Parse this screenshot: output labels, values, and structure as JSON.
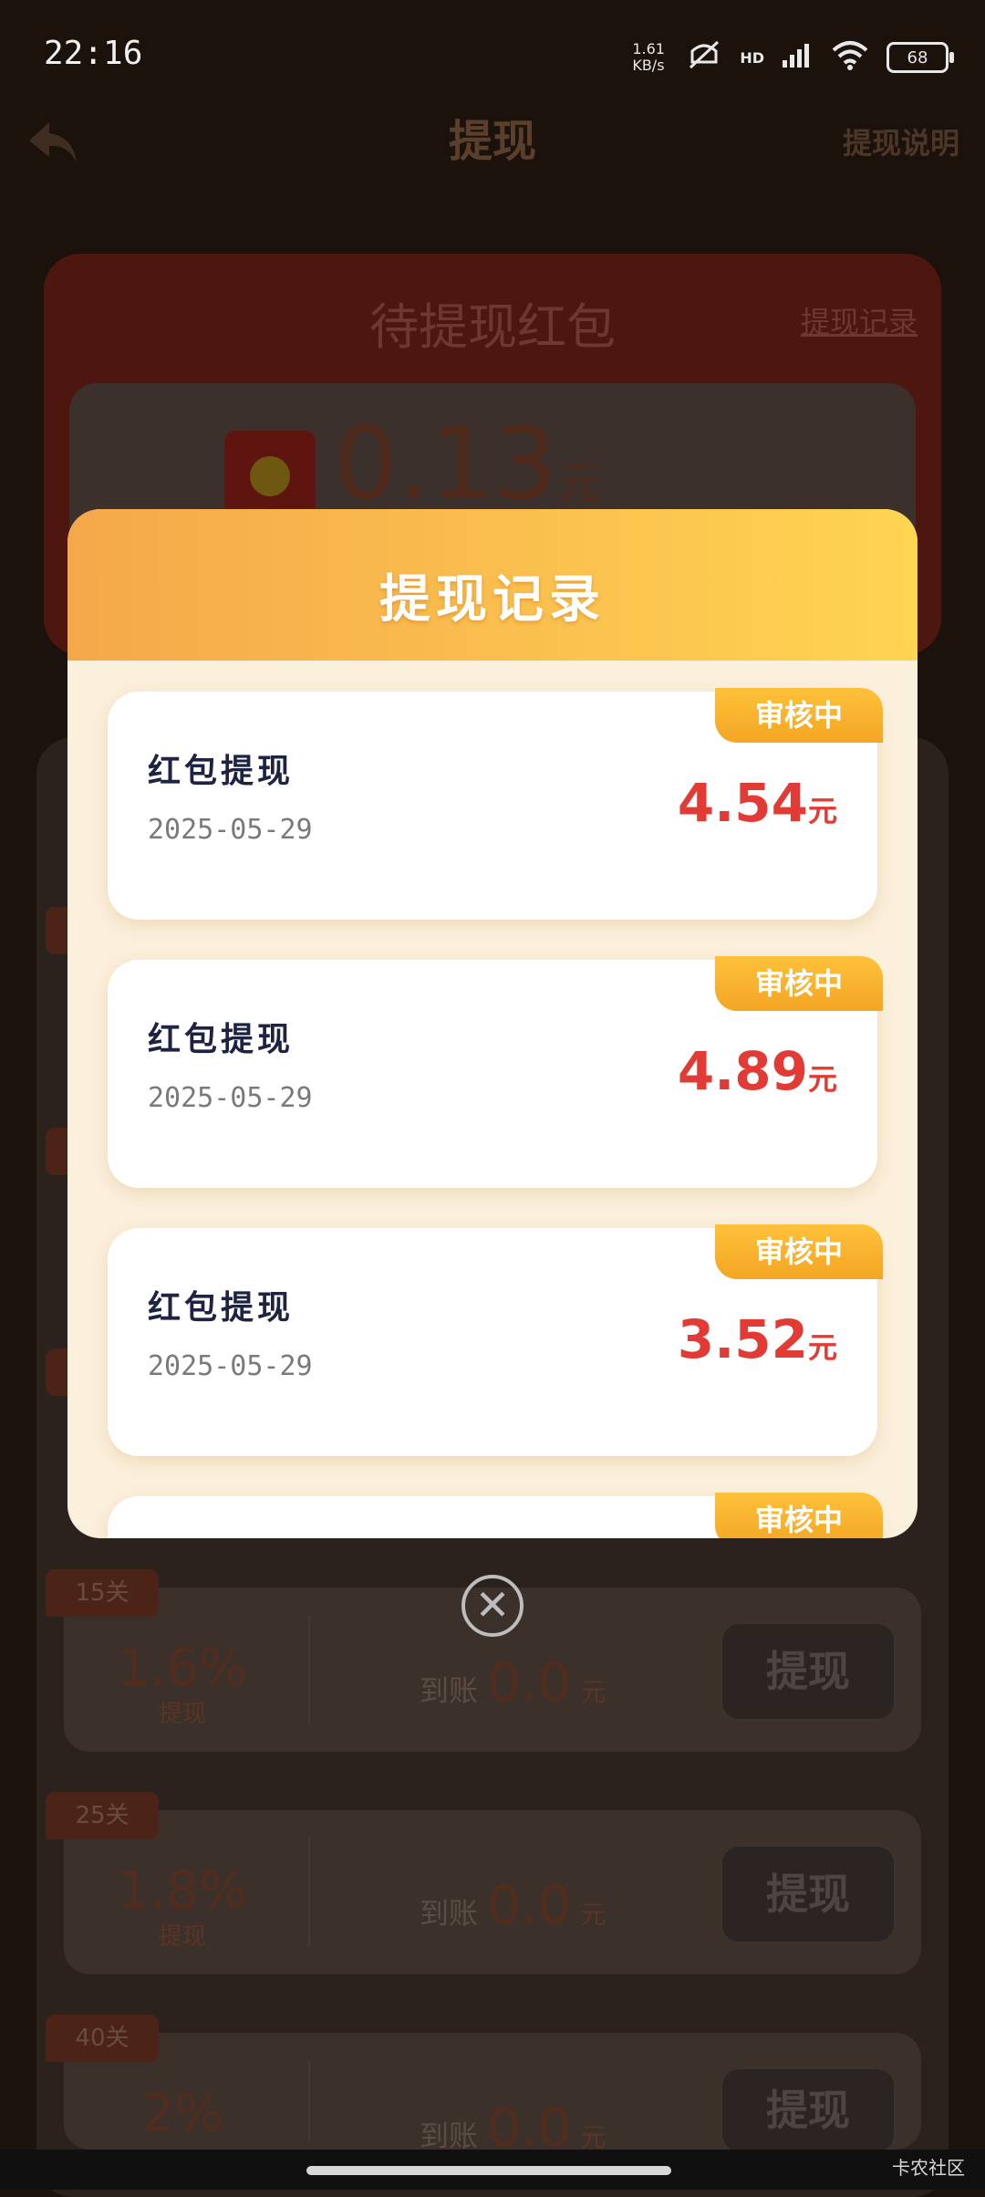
{
  "status": {
    "time": "22:16",
    "speed": "1.61 KB/s",
    "network": "HD",
    "battery": "68"
  },
  "header": {
    "title": "提现",
    "help": "提现说明"
  },
  "top_card": {
    "title": "待提现红包",
    "record_link": "提现记录",
    "balance": "0.13",
    "unit": "元"
  },
  "tiers": [
    {
      "badge": "15关",
      "rate": "1.6%",
      "rate_label": "提现",
      "arrive_label": "到账",
      "amount": "0.0",
      "unit": "元",
      "button": "提现"
    },
    {
      "badge": "25关",
      "rate": "1.8%",
      "rate_label": "提现",
      "arrive_label": "到账",
      "amount": "0.0",
      "unit": "元",
      "button": "提现"
    },
    {
      "badge": "40关",
      "rate": "2%",
      "rate_label": "",
      "arrive_label": "到账",
      "amount": "0.0",
      "unit": "元",
      "button": "提现"
    }
  ],
  "dialog": {
    "title": "提现记录",
    "records": [
      {
        "title": "红包提现",
        "date": "2025-05-29",
        "amount": "4.54",
        "unit": "元",
        "status": "审核中"
      },
      {
        "title": "红包提现",
        "date": "2025-05-29",
        "amount": "4.89",
        "unit": "元",
        "status": "审核中"
      },
      {
        "title": "红包提现",
        "date": "2025-05-29",
        "amount": "3.52",
        "unit": "元",
        "status": "审核中"
      },
      {
        "title": "",
        "date": "",
        "amount": "",
        "unit": "",
        "status": "审核中"
      }
    ],
    "close_icon": "close-circle-icon"
  },
  "watermark": "卡农社区"
}
